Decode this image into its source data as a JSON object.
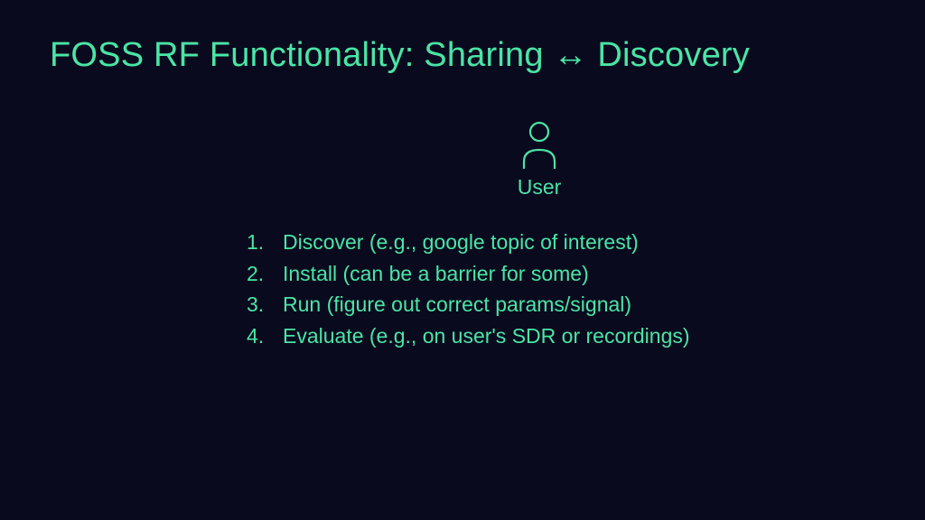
{
  "slide": {
    "title": "FOSS RF Functionality: Sharing ↔ Discovery",
    "user_label": "User",
    "steps": [
      "Discover (e.g., google topic of interest)",
      "Install (can be a barrier for some)",
      "Run (figure out correct params/signal)",
      "Evaluate (e.g., on user's SDR or recordings)"
    ]
  }
}
